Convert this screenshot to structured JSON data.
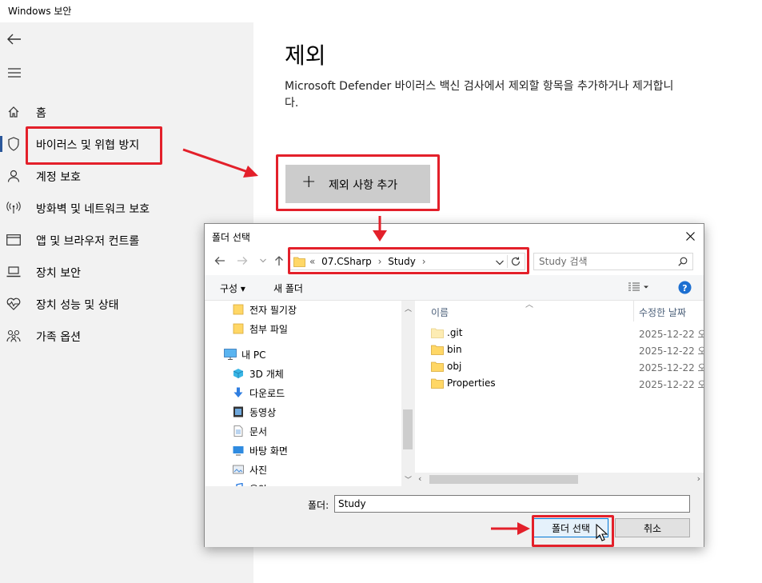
{
  "window": {
    "title": "Windows 보안"
  },
  "sidebar": {
    "items": [
      {
        "label": "홈",
        "icon": "home-icon"
      },
      {
        "label": "바이러스 및 위협 방지",
        "icon": "shield-icon",
        "selected": true
      },
      {
        "label": "계정 보호",
        "icon": "person-icon"
      },
      {
        "label": "방화벽 및 네트워크 보호",
        "icon": "antenna-icon"
      },
      {
        "label": "앱 및 브라우저 컨트롤",
        "icon": "app-window-icon"
      },
      {
        "label": "장치 보안",
        "icon": "laptop-icon"
      },
      {
        "label": "장치 성능 및 상태",
        "icon": "heart-pulse-icon"
      },
      {
        "label": "가족 옵션",
        "icon": "family-icon"
      }
    ]
  },
  "main": {
    "title": "제외",
    "description": "Microsoft Defender 바이러스 백신 검사에서 제외할 항목을 추가하거나 제거합니다.",
    "add_button": "제외 사항 추가"
  },
  "dialog": {
    "title": "폴더 선택",
    "breadcrumb": {
      "prefix": "«",
      "parts": [
        "07.CSharp",
        "Study"
      ]
    },
    "search_placeholder": "Study 검색",
    "toolbar": {
      "organize": "구성 ▾",
      "new_folder": "새 폴더"
    },
    "tree": [
      {
        "label": "전자 필기장",
        "icon": "folder-icon"
      },
      {
        "label": "첨부 파일",
        "icon": "folder-icon"
      },
      {
        "label": "내 PC",
        "icon": "computer-icon"
      },
      {
        "label": "3D 개체",
        "icon": "cube-icon"
      },
      {
        "label": "다운로드",
        "icon": "download-icon"
      },
      {
        "label": "동영상",
        "icon": "video-icon"
      },
      {
        "label": "문서",
        "icon": "document-icon"
      },
      {
        "label": "바탕 화면",
        "icon": "desktop-icon"
      },
      {
        "label": "사진",
        "icon": "picture-icon"
      },
      {
        "label": "음악",
        "icon": "music-icon"
      }
    ],
    "columns": {
      "name": "이름",
      "modified": "수정한 날짜"
    },
    "files": [
      {
        "name": ".git",
        "modified": "2025-12-22 오",
        "hidden": true
      },
      {
        "name": "bin",
        "modified": "2025-12-22 오"
      },
      {
        "name": "obj",
        "modified": "2025-12-22 오"
      },
      {
        "name": "Properties",
        "modified": "2025-12-22 오"
      }
    ],
    "folder_label": "폴더:",
    "folder_value": "Study",
    "select_button": "폴더 선택",
    "cancel_button": "취소"
  },
  "colors": {
    "annotation": "#e3202a",
    "accent": "#0078d7",
    "folder": "#ffd766"
  }
}
